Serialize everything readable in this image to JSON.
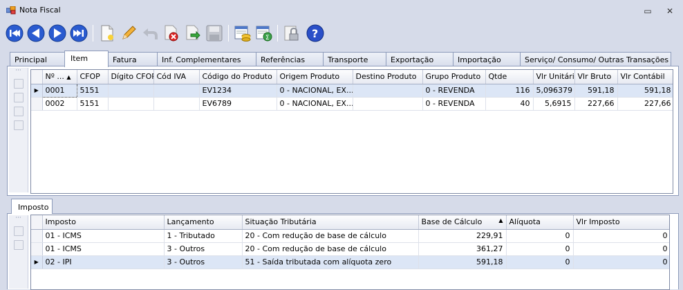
{
  "window": {
    "title": "Nota Fiscal",
    "minimize_glyph": "▭",
    "close_glyph": "✕"
  },
  "toolbar": {
    "icons": [
      "first-record-icon",
      "previous-record-icon",
      "next-record-icon",
      "last-record-icon",
      "new-document-icon",
      "edit-icon",
      "undo-icon",
      "delete-icon",
      "confirm-icon",
      "save-icon",
      "database-icon",
      "calculate-icon",
      "lock-icon",
      "help-icon"
    ],
    "help_glyph": "?"
  },
  "tabs": [
    {
      "label": "Principal"
    },
    {
      "label": "Item"
    },
    {
      "label": "Fatura"
    },
    {
      "label": "Inf. Complementares"
    },
    {
      "label": "Referências"
    },
    {
      "label": "Transporte"
    },
    {
      "label": "Exportação"
    },
    {
      "label": "Importação"
    },
    {
      "label": "Serviço/ Consumo/ Outras Transações"
    }
  ],
  "items_grid": {
    "columns": [
      "Nº ...",
      "CFOP",
      "Dígito CFOP",
      "Cód IVA",
      "Código do Produto",
      "Origem Produto",
      "Destino Produto",
      "Grupo Produto",
      "Qtde",
      "Vlr Unitário",
      "Vlr Bruto",
      "Vlr Contábil"
    ],
    "sort_glyph": "▲",
    "row_pointer": "▶",
    "rows": [
      {
        "num": "0001",
        "cfop": "5151",
        "digito": "",
        "iva": "",
        "codigo": "EV1234",
        "origem": "0 - NACIONAL, EX...",
        "destino": "",
        "grupo": "0 - REVENDA",
        "qtde": "116",
        "unit": "5,096379",
        "bruto": "591,18",
        "contabil": "591,18"
      },
      {
        "num": "0002",
        "cfop": "5151",
        "digito": "",
        "iva": "",
        "codigo": "EV6789",
        "origem": "0 - NACIONAL, EX...",
        "destino": "",
        "grupo": "0 - REVENDA",
        "qtde": "40",
        "unit": "5,6915",
        "bruto": "227,66",
        "contabil": "227,66"
      }
    ]
  },
  "tax_tab": {
    "label": "Imposto"
  },
  "tax_grid": {
    "columns": [
      "Imposto",
      "Lançamento",
      "Situação Tributária",
      "Base de Cálculo",
      "Alíquota",
      "Vlr Imposto"
    ],
    "sort_glyph": "▲",
    "row_pointer": "▶",
    "rows": [
      {
        "imposto": "01 - ICMS",
        "lanc": "1 - Tributado",
        "situacao": "20 - Com redução de base de cálculo",
        "base": "229,91",
        "aliquota": "0",
        "valor": "0"
      },
      {
        "imposto": "01 - ICMS",
        "lanc": "3 - Outros",
        "situacao": "20 - Com redução de base de cálculo",
        "base": "361,27",
        "aliquota": "0",
        "valor": "0"
      },
      {
        "imposto": "02 - IPI",
        "lanc": "3 - Outros",
        "situacao": "51 - Saída tributada com alíquota zero",
        "base": "591,18",
        "aliquota": "0",
        "valor": "0"
      }
    ]
  }
}
